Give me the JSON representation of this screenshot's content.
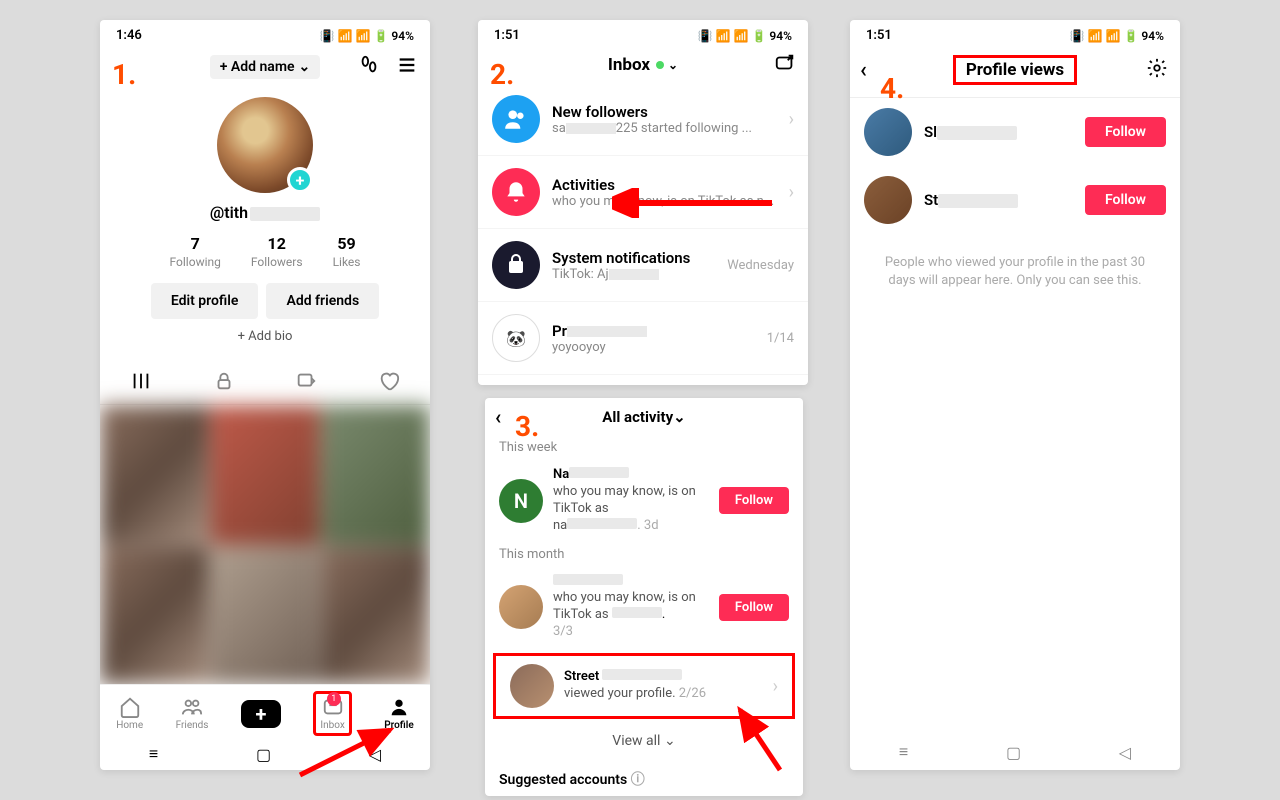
{
  "status": {
    "time1": "1:46",
    "time2": "1:51",
    "battery": "94%"
  },
  "p1": {
    "add_name": "+ Add name",
    "username_prefix": "@tith",
    "following_n": "7",
    "following_l": "Following",
    "followers_n": "12",
    "followers_l": "Followers",
    "likes_n": "59",
    "likes_l": "Likes",
    "edit_profile": "Edit profile",
    "add_friends": "Add friends",
    "add_bio": "+ Add bio",
    "nav_home": "Home",
    "nav_friends": "Friends",
    "nav_inbox": "Inbox",
    "nav_profile": "Profile",
    "inbox_badge": "1"
  },
  "p2": {
    "header": "Inbox",
    "items": [
      {
        "title": "New followers",
        "sub1": "sa",
        "sub2": "225 started following ..."
      },
      {
        "title": "Activities",
        "sub": "who you may know, is on TikTok as n..."
      },
      {
        "title": "System notifications",
        "sub1": "TikTok: Aj",
        "right": "Wednesday"
      },
      {
        "title1": "Pr",
        "sub": "yoyooyoy",
        "right": "1/14"
      }
    ]
  },
  "p3": {
    "header": "All activity",
    "this_week": "This week",
    "this_month": "This month",
    "act1_name": "Na",
    "act1_sub": "who you may know, is on TikTok as",
    "act1_handle": "na",
    "act1_date": ". 3d",
    "act2_sub": "who you may know, is on TikTok as ",
    "act2_date": "3/3",
    "act3_name": "Street",
    "act3_sub": "viewed your profile.",
    "act3_date": " 2/26",
    "follow": "Follow",
    "view_all": "View all",
    "suggested": "Suggested accounts"
  },
  "p4": {
    "title": "Profile views",
    "u1": "Sl",
    "u2": "St",
    "follow": "Follow",
    "footer": "People who viewed your profile in the past 30 days will appear here. Only you can see this."
  },
  "steps": {
    "s1": "1.",
    "s2": "2.",
    "s3": "3.",
    "s4": "4."
  }
}
